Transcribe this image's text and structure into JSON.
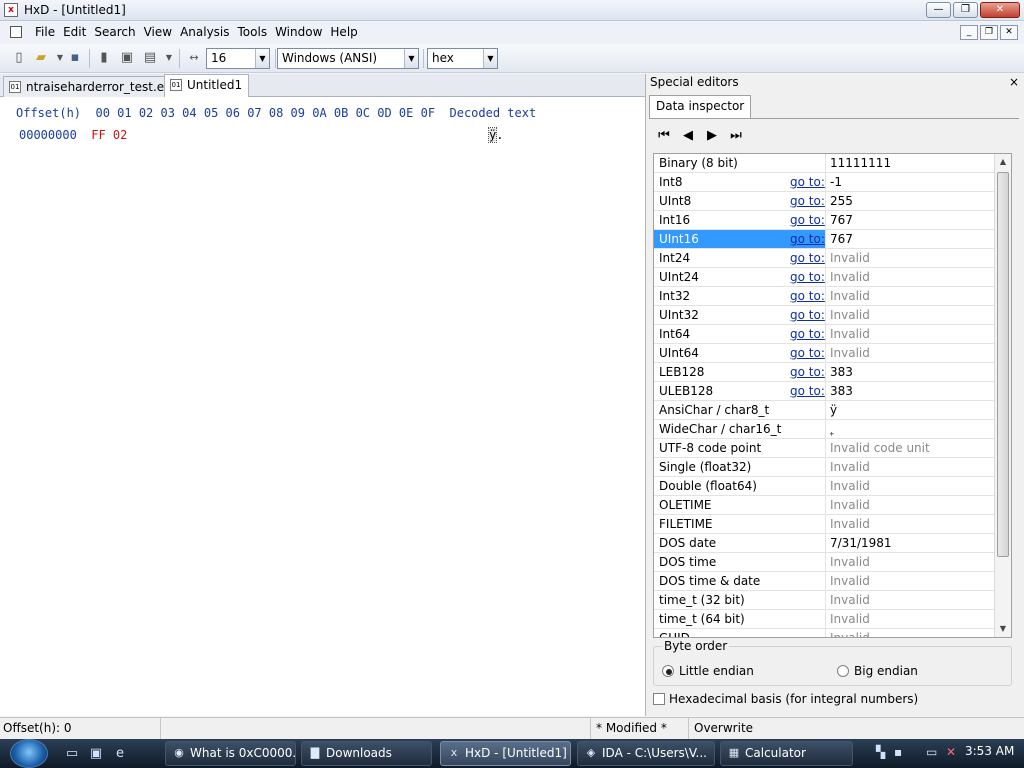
{
  "window": {
    "title": "HxD - [Untitled1]"
  },
  "menu": [
    "File",
    "Edit",
    "Search",
    "View",
    "Analysis",
    "Tools",
    "Window",
    "Help"
  ],
  "toolbar": {
    "bytes_per_row": "16",
    "charset": "Windows (ANSI)",
    "offset_base": "hex"
  },
  "tabs": [
    {
      "label": "ntraiseharderror_test.exe",
      "active": false
    },
    {
      "label": "Untitled1",
      "active": true
    }
  ],
  "hex": {
    "header_offset": "Offset(h)",
    "header_columns": "00 01 02 03 04 05 06 07 08 09 0A 0B 0C 0D 0E 0F",
    "header_decoded": "Decoded text",
    "row_offset": "00000000",
    "row_bytes": "FF 02",
    "decoded_char": "ÿ",
    "decoded_rest": "."
  },
  "panel": {
    "title": "Special editors",
    "close": "×",
    "tab": "Data inspector",
    "nav": [
      "⏮",
      "◀",
      "▶",
      "⏭"
    ],
    "goto_label": "go to:",
    "rows": [
      {
        "name": "Binary (8 bit)",
        "goto": false,
        "value": "11111111",
        "dim": false
      },
      {
        "name": "Int8",
        "goto": true,
        "value": "-1",
        "dim": false
      },
      {
        "name": "UInt8",
        "goto": true,
        "value": "255",
        "dim": false
      },
      {
        "name": "Int16",
        "goto": true,
        "value": "767",
        "dim": false
      },
      {
        "name": "UInt16",
        "goto": true,
        "value": "767",
        "dim": false,
        "selected": true
      },
      {
        "name": "Int24",
        "goto": true,
        "value": "Invalid",
        "dim": true
      },
      {
        "name": "UInt24",
        "goto": true,
        "value": "Invalid",
        "dim": true
      },
      {
        "name": "Int32",
        "goto": true,
        "value": "Invalid",
        "dim": true
      },
      {
        "name": "UInt32",
        "goto": true,
        "value": "Invalid",
        "dim": true
      },
      {
        "name": "Int64",
        "goto": true,
        "value": "Invalid",
        "dim": true
      },
      {
        "name": "UInt64",
        "goto": true,
        "value": "Invalid",
        "dim": true
      },
      {
        "name": "LEB128",
        "goto": true,
        "value": "383",
        "dim": false
      },
      {
        "name": "ULEB128",
        "goto": true,
        "value": "383",
        "dim": false
      },
      {
        "name": "AnsiChar / char8_t",
        "goto": false,
        "value": "ÿ",
        "dim": false
      },
      {
        "name": "WideChar / char16_t",
        "goto": false,
        "value": "˿",
        "dim": false
      },
      {
        "name": "UTF-8 code point",
        "goto": false,
        "value": "Invalid code unit",
        "dim": true
      },
      {
        "name": "Single (float32)",
        "goto": false,
        "value": "Invalid",
        "dim": true
      },
      {
        "name": "Double (float64)",
        "goto": false,
        "value": "Invalid",
        "dim": true
      },
      {
        "name": "OLETIME",
        "goto": false,
        "value": "Invalid",
        "dim": true
      },
      {
        "name": "FILETIME",
        "goto": false,
        "value": "Invalid",
        "dim": true
      },
      {
        "name": "DOS date",
        "goto": false,
        "value": "7/31/1981",
        "dim": false
      },
      {
        "name": "DOS time",
        "goto": false,
        "value": "Invalid",
        "dim": true
      },
      {
        "name": "DOS time & date",
        "goto": false,
        "value": "Invalid",
        "dim": true
      },
      {
        "name": "time_t (32 bit)",
        "goto": false,
        "value": "Invalid",
        "dim": true
      },
      {
        "name": "time_t (64 bit)",
        "goto": false,
        "value": "Invalid",
        "dim": true
      },
      {
        "name": "GUID",
        "goto": false,
        "value": "Invalid",
        "dim": true
      }
    ],
    "byte_order": {
      "legend": "Byte order",
      "little": "Little endian",
      "big": "Big endian",
      "selected": "little"
    },
    "hex_basis": "Hexadecimal basis (for integral numbers)"
  },
  "status": {
    "offset": "Offset(h): 0",
    "modified": "* Modified *",
    "mode": "Overwrite"
  },
  "taskbar": {
    "tasks": [
      {
        "label": "What is 0xC0000...",
        "icon": "chrome-icon",
        "active": false
      },
      {
        "label": "Downloads",
        "icon": "folder-icon",
        "active": false
      },
      {
        "label": "HxD - [Untitled1]",
        "icon": "hxd-icon",
        "active": true
      },
      {
        "label": "IDA - C:\\Users\\V...",
        "icon": "ida-icon",
        "active": false
      },
      {
        "label": "Calculator",
        "icon": "calculator-icon",
        "active": false
      }
    ],
    "clock": "3:53 AM"
  }
}
